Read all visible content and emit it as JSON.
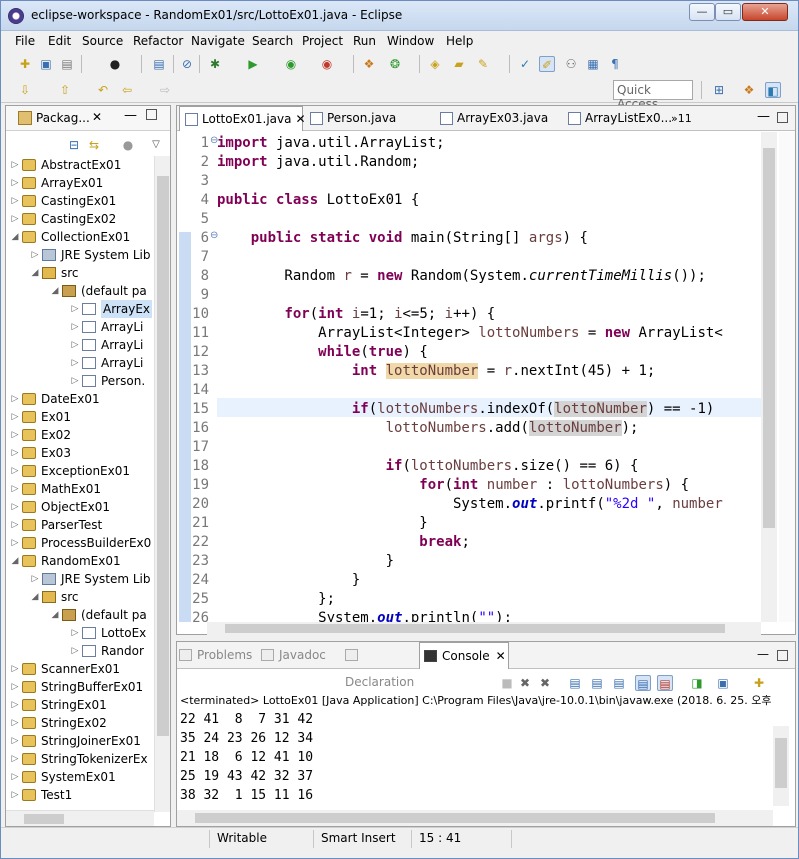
{
  "window": {
    "title": "eclipse-workspace - RandomEx01/src/LottoEx01.java - Eclipse"
  },
  "menu": [
    "File",
    "Edit",
    "Source",
    "Refactor",
    "Navigate",
    "Search",
    "Project",
    "Run",
    "Window",
    "Help"
  ],
  "quick_access": "Quick Access",
  "package_explorer": {
    "title": "Packag...",
    "items": [
      {
        "label": "AbstractEx01",
        "level": 0,
        "icon": "project-icon",
        "arrow": "right"
      },
      {
        "label": "ArrayEx01",
        "level": 0,
        "icon": "project-icon",
        "arrow": "right"
      },
      {
        "label": "CastingEx01",
        "level": 0,
        "icon": "project-icon",
        "arrow": "right"
      },
      {
        "label": "CastingEx02",
        "level": 0,
        "icon": "project-icon",
        "arrow": "right"
      },
      {
        "label": "CollectionEx01",
        "level": 0,
        "icon": "project-icon",
        "arrow": "down"
      },
      {
        "label": "JRE System Lib",
        "level": 1,
        "icon": "library-icon",
        "arrow": "right"
      },
      {
        "label": "src",
        "level": 1,
        "icon": "source-folder-icon",
        "arrow": "down"
      },
      {
        "label": "(default pa",
        "level": 2,
        "icon": "package-icon",
        "arrow": "down"
      },
      {
        "label": "ArrayEx",
        "level": 3,
        "icon": "java-file-icon",
        "arrow": "right",
        "selected": true
      },
      {
        "label": "ArrayLi",
        "level": 3,
        "icon": "java-file-icon",
        "arrow": "right"
      },
      {
        "label": "ArrayLi",
        "level": 3,
        "icon": "java-file-icon",
        "arrow": "right"
      },
      {
        "label": "ArrayLi",
        "level": 3,
        "icon": "java-file-icon",
        "arrow": "right"
      },
      {
        "label": "Person.",
        "level": 3,
        "icon": "java-file-icon",
        "arrow": "right"
      },
      {
        "label": "DateEx01",
        "level": 0,
        "icon": "project-icon",
        "arrow": "right"
      },
      {
        "label": "Ex01",
        "level": 0,
        "icon": "project-icon",
        "arrow": "right"
      },
      {
        "label": "Ex02",
        "level": 0,
        "icon": "project-icon",
        "arrow": "right"
      },
      {
        "label": "Ex03",
        "level": 0,
        "icon": "project-icon",
        "arrow": "right"
      },
      {
        "label": "ExceptionEx01",
        "level": 0,
        "icon": "project-icon",
        "arrow": "right"
      },
      {
        "label": "MathEx01",
        "level": 0,
        "icon": "project-icon",
        "arrow": "right"
      },
      {
        "label": "ObjectEx01",
        "level": 0,
        "icon": "project-icon",
        "arrow": "right"
      },
      {
        "label": "ParserTest",
        "level": 0,
        "icon": "project-icon",
        "arrow": "right"
      },
      {
        "label": "ProcessBuilderEx0",
        "level": 0,
        "icon": "project-icon",
        "arrow": "right"
      },
      {
        "label": "RandomEx01",
        "level": 0,
        "icon": "project-icon",
        "arrow": "down"
      },
      {
        "label": "JRE System Lib",
        "level": 1,
        "icon": "library-icon",
        "arrow": "right"
      },
      {
        "label": "src",
        "level": 1,
        "icon": "source-folder-icon",
        "arrow": "down"
      },
      {
        "label": "(default pa",
        "level": 2,
        "icon": "package-icon",
        "arrow": "down"
      },
      {
        "label": "LottoEx",
        "level": 3,
        "icon": "java-file-icon",
        "arrow": "right"
      },
      {
        "label": "Randor",
        "level": 3,
        "icon": "java-file-icon",
        "arrow": "right"
      },
      {
        "label": "ScannerEx01",
        "level": 0,
        "icon": "project-icon",
        "arrow": "right"
      },
      {
        "label": "StringBufferEx01",
        "level": 0,
        "icon": "project-icon",
        "arrow": "right"
      },
      {
        "label": "StringEx01",
        "level": 0,
        "icon": "project-icon",
        "arrow": "right"
      },
      {
        "label": "StringEx02",
        "level": 0,
        "icon": "project-icon",
        "arrow": "right"
      },
      {
        "label": "StringJoinerEx01",
        "level": 0,
        "icon": "project-icon",
        "arrow": "right"
      },
      {
        "label": "StringTokenizerEx",
        "level": 0,
        "icon": "project-icon",
        "arrow": "right"
      },
      {
        "label": "SystemEx01",
        "level": 0,
        "icon": "project-icon",
        "arrow": "right"
      },
      {
        "label": "Test1",
        "level": 0,
        "icon": "project-icon",
        "arrow": "right"
      }
    ]
  },
  "editor": {
    "tabs": [
      {
        "label": "LottoEx01.java",
        "active": true,
        "close": "✕"
      },
      {
        "label": "Person.java"
      },
      {
        "label": "ArrayEx03.java"
      },
      {
        "label": "ArrayListEx0..."
      }
    ],
    "more_tabs": "»11",
    "lines": [
      {
        "n": "1",
        "marker": "⊖",
        "html": "<span class=\"kw\">import</span> java.util.ArrayList;"
      },
      {
        "n": "2",
        "html": "<span class=\"kw\">import</span> java.util.Random;"
      },
      {
        "n": "3",
        "html": ""
      },
      {
        "n": "4",
        "html": "<span class=\"kw\">public</span> <span class=\"kw\">class</span> LottoEx01 {"
      },
      {
        "n": "5",
        "html": ""
      },
      {
        "n": "6",
        "marker": "⊖",
        "html": "    <span class=\"kw\">public</span> <span class=\"kw\">static</span> <span class=\"kw\">void</span> main(String[] <span class=\"var\">args</span>) {"
      },
      {
        "n": "7",
        "html": ""
      },
      {
        "n": "8",
        "html": "        Random <span class=\"var\">r</span> = <span class=\"kw\">new</span> Random(System.<span class=\"it\">currentTimeMillis</span>());"
      },
      {
        "n": "9",
        "html": ""
      },
      {
        "n": "10",
        "html": "        <span class=\"kw\">for</span>(<span class=\"kw\">int</span> <span class=\"var\">i</span>=1; <span class=\"var\">i</span>&lt;=5; <span class=\"var\">i</span>++) {"
      },
      {
        "n": "11",
        "html": "            ArrayList&lt;Integer&gt; <span class=\"var\">lottoNumbers</span> = <span class=\"kw\">new</span> ArrayList&lt;"
      },
      {
        "n": "12",
        "html": "            <span class=\"kw\">while</span>(<span class=\"kw\">true</span>) {"
      },
      {
        "n": "13",
        "html": "                <span class=\"kw\">int</span> <span class=\"var hl1\">lottoNumber</span> = <span class=\"var\">r</span>.nextInt(45) + 1;"
      },
      {
        "n": "14",
        "html": ""
      },
      {
        "n": "15",
        "html": "                <span class=\"kw\">if</span>(<span class=\"var\">lottoNumbers</span>.indexOf(<span class=\"var hl2\">lottoNumber</span>) == -1)"
      },
      {
        "n": "16",
        "html": "                    <span class=\"var\">lottoNumbers</span>.add(<span class=\"var hl2\">lottoNumber</span>);"
      },
      {
        "n": "17",
        "html": ""
      },
      {
        "n": "18",
        "html": "                    <span class=\"kw\">if</span>(<span class=\"var\">lottoNumbers</span>.size() == 6) {"
      },
      {
        "n": "19",
        "html": "                        <span class=\"kw\">for</span>(<span class=\"kw\">int</span> <span class=\"var\">number</span> : <span class=\"var\">lottoNumbers</span>) {"
      },
      {
        "n": "20",
        "html": "                            System.<span class=\"fld\">out</span>.printf(<span class=\"str\">\"%2d \"</span>, <span class=\"var\">number</span>"
      },
      {
        "n": "21",
        "html": "                        }"
      },
      {
        "n": "22",
        "html": "                        <span class=\"kw\">break</span>;"
      },
      {
        "n": "23",
        "html": "                    }"
      },
      {
        "n": "24",
        "html": "                }"
      },
      {
        "n": "25",
        "html": "            };"
      },
      {
        "n": "26",
        "html": "            System.<span class=\"fld\">out</span>.println(<span class=\"str\">\"\"</span>);"
      }
    ]
  },
  "console": {
    "tabs": [
      {
        "label": "Problems",
        "icon": "problems-icon"
      },
      {
        "label": "Javadoc",
        "icon": "javadoc-icon"
      },
      {
        "label": "Declaration",
        "icon": "declaration-icon"
      },
      {
        "label": "Console",
        "icon": "console-icon",
        "active": true,
        "close": "✕"
      }
    ],
    "terminated": "<terminated> LottoEx01 [Java Application] C:\\Program Files\\Java\\jre-10.0.1\\bin\\javaw.exe (2018. 6. 25. 오후",
    "output": [
      "22 41  8  7 31 42",
      "35 24 23 26 12 34",
      "21 18  6 12 41 10",
      "25 19 43 42 32 37",
      "38 32  1 15 11 16"
    ]
  },
  "status": {
    "writable": "Writable",
    "insert": "Smart Insert",
    "position": "15 : 41"
  }
}
